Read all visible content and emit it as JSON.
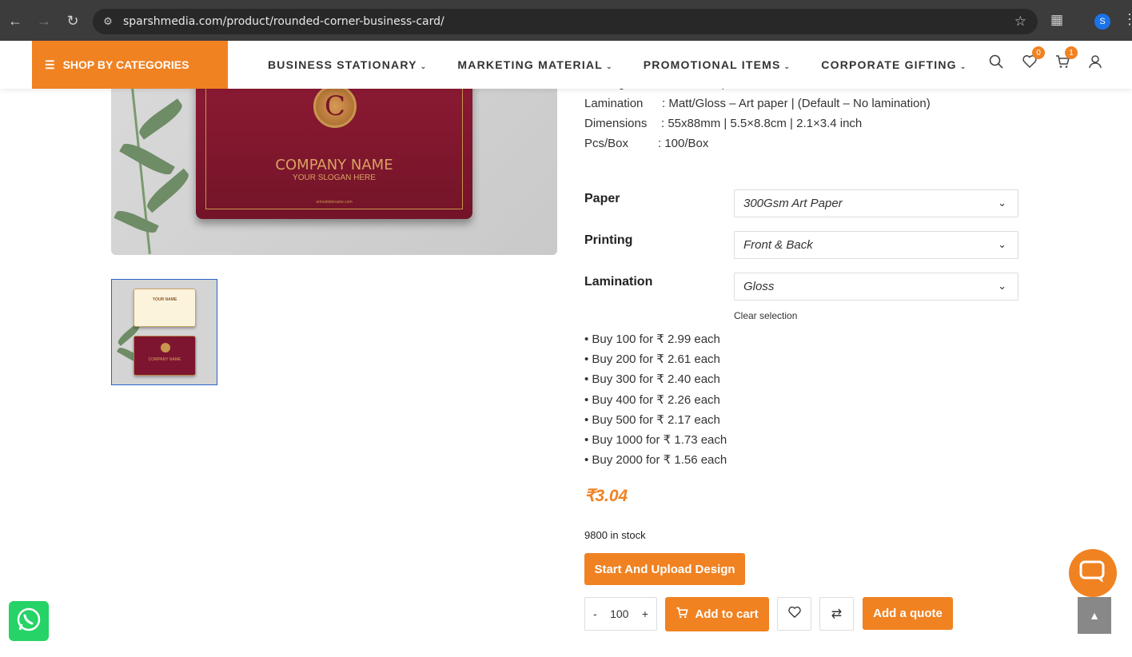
{
  "browser": {
    "url": "sparshmedia.com/product/rounded-corner-business-card/",
    "profile_initial": "S"
  },
  "header": {
    "shop_by_categories": "SHOP BY CATEGORIES",
    "nav": [
      {
        "label": "BUSINESS STATIONARY"
      },
      {
        "label": "MARKETING MATERIAL"
      },
      {
        "label": "PROMOTIONAL ITEMS"
      },
      {
        "label": "CORPORATE GIFTING"
      }
    ],
    "wishlist_count": "0",
    "cart_count": "1"
  },
  "gallery": {
    "company_name": "COMPANY NAME",
    "slogan": "YOUR SLOGAN HERE",
    "logo_letter": "C",
    "website": "armedsitename.com",
    "thumb_name": "YOUR NAME",
    "thumb_company": "COMPANY NAME"
  },
  "specs": [
    {
      "key": "Printing",
      "value": ": Front side | Front & Back"
    },
    {
      "key": "Lamination",
      "value": ": Matt/Gloss –  Art paper | (Default – No lamination)"
    },
    {
      "key": "Dimensions",
      "value": ": 55x88mm | 5.5×8.8cm | 2.1×3.4 inch"
    },
    {
      "key": "Pcs/Box",
      "value": ": 100/Box"
    }
  ],
  "variations": {
    "paper_label": "Paper",
    "paper_value": "300Gsm Art Paper",
    "printing_label": "Printing",
    "printing_value": "Front & Back",
    "lamination_label": "Lamination",
    "lamination_value": "Gloss",
    "clear_selection": "Clear selection"
  },
  "tiers": [
    "• Buy 100 for ₹ 2.99 each",
    "• Buy 200 for ₹ 2.61 each",
    "• Buy 300 for ₹ 2.40 each",
    "• Buy 400 for ₹ 2.26 each",
    "• Buy 500 for ₹ 2.17 each",
    "• Buy 1000 for ₹ 1.73 each",
    "• Buy 2000 for ₹ 1.56 each"
  ],
  "price": "₹3.04",
  "stock": "9800 in stock",
  "actions": {
    "start_upload": "Start And Upload Design",
    "qty_minus": "-",
    "qty_value": "100",
    "qty_plus": "+",
    "add_to_cart": "Add to cart",
    "add_quote": "Add a quote"
  },
  "colors": {
    "accent": "#f08222",
    "browser_bar": "#3c3c3c",
    "whatsapp": "#25d366",
    "card_red": "#7d1530"
  }
}
